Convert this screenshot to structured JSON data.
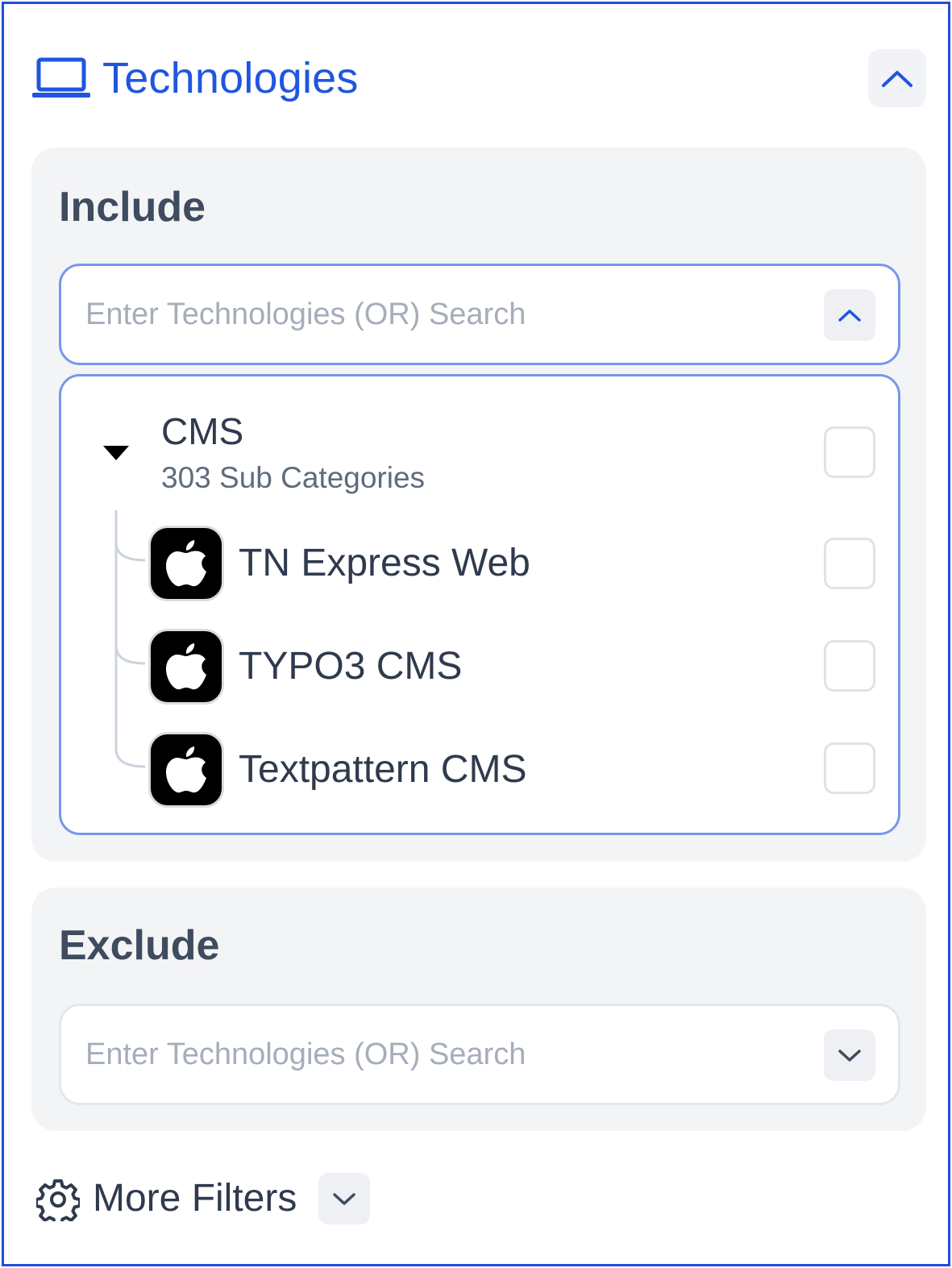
{
  "header": {
    "icon": "laptop-icon",
    "title": "Technologies",
    "collapse_icon": "chevron-up-icon",
    "accent_color": "#1f56e0"
  },
  "include": {
    "title": "Include",
    "search": {
      "placeholder": "Enter Technologies (OR) Search",
      "value": "",
      "toggle_icon": "chevron-up-icon"
    },
    "dropdown": {
      "group": {
        "name": "CMS",
        "subtitle": "303 Sub Categories",
        "expanded": true,
        "checked": false
      },
      "items": [
        {
          "label": "TN Express Web",
          "icon": "apple-icon",
          "checked": false
        },
        {
          "label": "TYPO3 CMS",
          "icon": "apple-icon",
          "checked": false
        },
        {
          "label": "Textpattern CMS",
          "icon": "apple-icon",
          "checked": false
        }
      ]
    }
  },
  "exclude": {
    "title": "Exclude",
    "search": {
      "placeholder": "Enter Technologies (OR) Search",
      "value": "",
      "toggle_icon": "chevron-down-icon"
    }
  },
  "more_filters": {
    "icon": "gear-icon",
    "label": "More Filters",
    "toggle_icon": "chevron-down-icon"
  }
}
